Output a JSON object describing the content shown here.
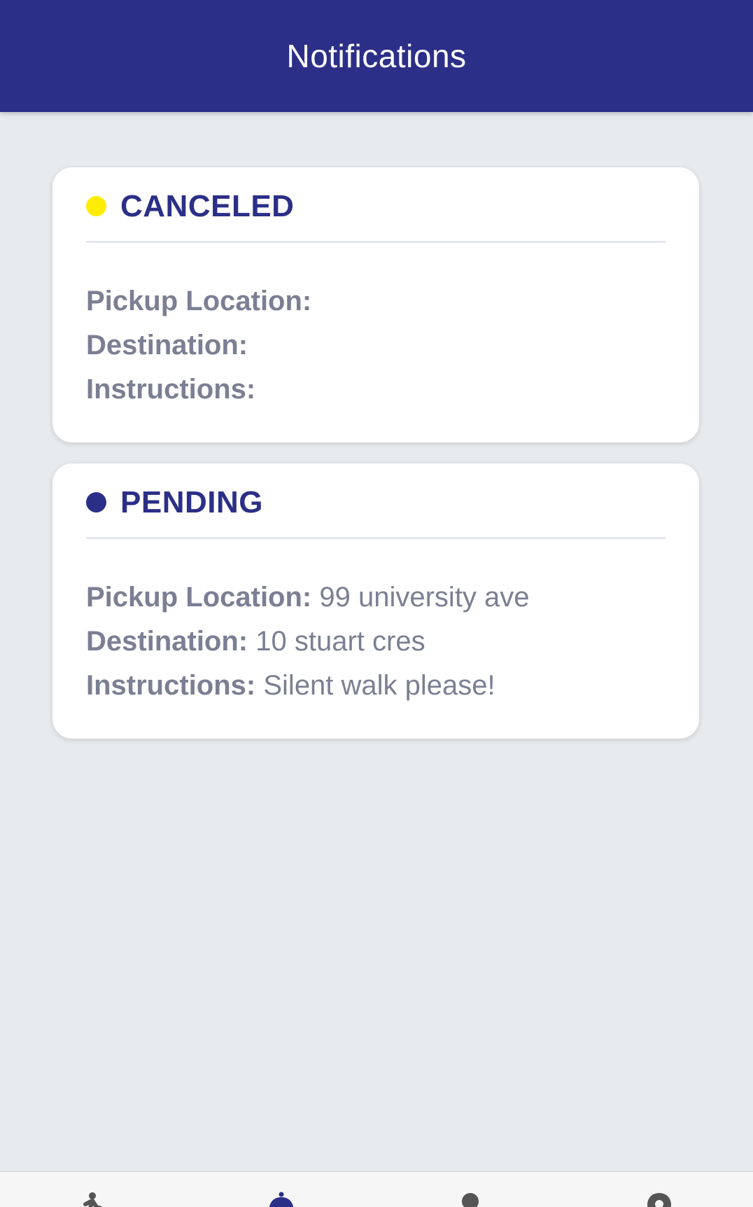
{
  "header": {
    "title": "Notifications",
    "color": "#2c2f87"
  },
  "notifications": [
    {
      "status": "CANCELED",
      "status_color": "#ffec00",
      "pickup_label": "Pickup Location:",
      "pickup_value": "",
      "destination_label": "Destination:",
      "destination_value": "",
      "instructions_label": "Instructions:",
      "instructions_value": ""
    },
    {
      "status": "PENDING",
      "status_color": "#2c2f87",
      "pickup_label": "Pickup Location:",
      "pickup_value": "99 university ave",
      "destination_label": "Destination:",
      "destination_value": "10 stuart cres",
      "instructions_label": "Instructions:",
      "instructions_value": "Silent walk please!"
    }
  ],
  "bottom_nav": {
    "items": [
      {
        "icon": "walk-icon",
        "active": false
      },
      {
        "icon": "notification-bell-icon",
        "active": true
      },
      {
        "icon": "profile-icon",
        "active": false
      },
      {
        "icon": "location-pin-icon",
        "active": false
      }
    ],
    "active_color": "#2c2f87",
    "inactive_color": "#555555"
  }
}
